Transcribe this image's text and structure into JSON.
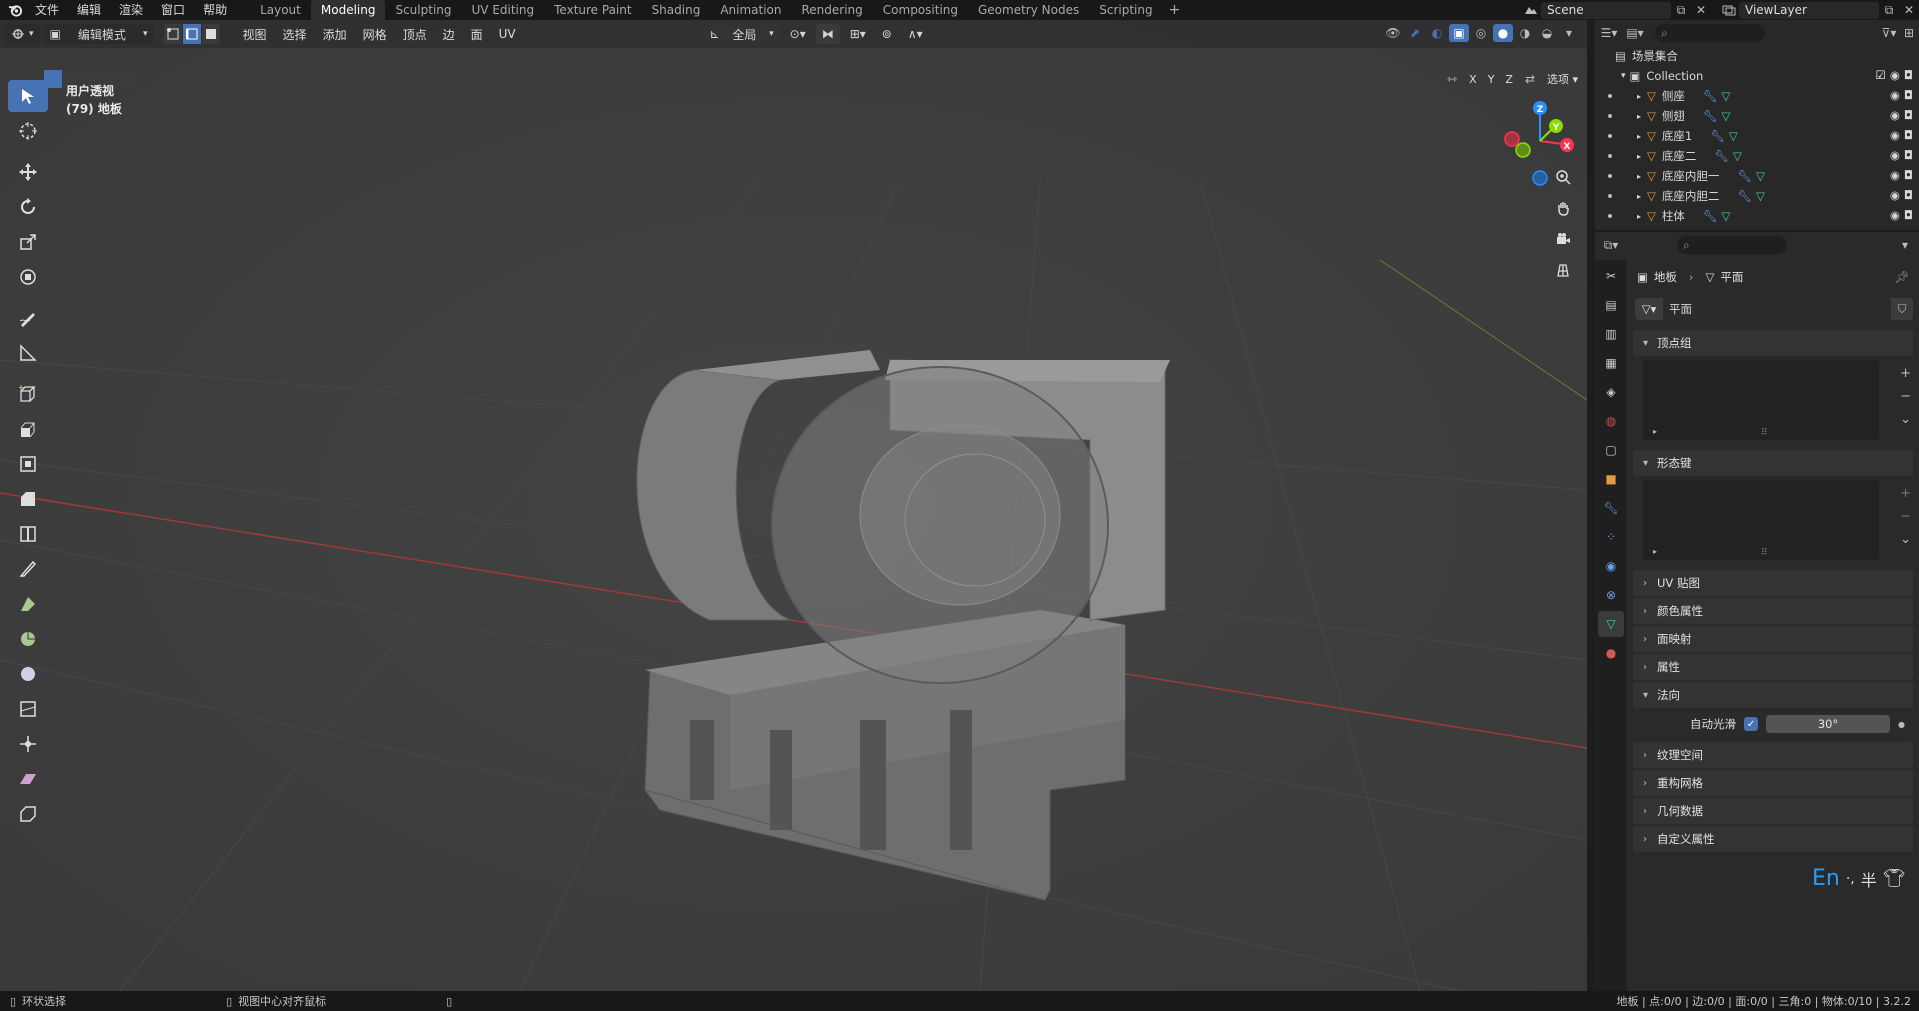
{
  "top_menu": [
    "文件",
    "编辑",
    "渲染",
    "窗口",
    "帮助"
  ],
  "workspaces": [
    "Layout",
    "Modeling",
    "Sculpting",
    "UV Editing",
    "Texture Paint",
    "Shading",
    "Animation",
    "Rendering",
    "Compositing",
    "Geometry Nodes",
    "Scripting"
  ],
  "active_workspace": "Modeling",
  "scene_name": "Scene",
  "view_layer": "ViewLayer",
  "viewport": {
    "mode": "编辑模式",
    "menus": [
      "视图",
      "选择",
      "添加",
      "网格",
      "顶点",
      "边",
      "面",
      "UV"
    ],
    "transform_orientation": "全局",
    "options_label": "选项",
    "mirror_axes": [
      "X",
      "Y",
      "Z"
    ],
    "view_name": "用户透视",
    "object_info": "(79) 地板"
  },
  "gizmo": {
    "x": "X",
    "y": "Y",
    "z": "Z"
  },
  "outliner": {
    "root": "场景集合",
    "collection": "Collection",
    "objects": [
      "侧座",
      "侧翅",
      "底座1",
      "底座二",
      "底座内胆一",
      "底座内胆二",
      "柱体"
    ]
  },
  "properties": {
    "breadcrumb_object": "地板",
    "breadcrumb_mesh": "平面",
    "mesh_name": "平面",
    "panels": {
      "vertex_groups": "顶点组",
      "shape_keys": "形态键",
      "uv_maps": "UV 贴图",
      "color_attributes": "颜色属性",
      "face_maps": "面映射",
      "attributes": "属性",
      "normals": "法向",
      "texture_space": "纹理空间",
      "remesh": "重构网格",
      "geometry_data": "几何数据",
      "custom_props": "自定义属性"
    },
    "auto_smooth_label": "自动光滑",
    "auto_smooth_checked": true,
    "auto_smooth_angle": "30°"
  },
  "ime": {
    "lang": "En",
    "punct": "·,",
    "width": "半"
  },
  "statusbar": {
    "left_action": "环状选择",
    "mid_action": "视图中心对齐鼠标",
    "stats": "地板 | 点:0/0 | 边:0/0 | 面:0/0 | 三角:0 | 物体:0/10 | 3.2.2"
  },
  "colors": {
    "accent": "#4772b3",
    "object_icon": "#e59a3d",
    "mesh_icon": "#49c8a0",
    "modifier_icon": "#6a9dea",
    "axis_x": "#ff3352",
    "axis_y": "#8bdc00",
    "axis_z": "#2890ff"
  }
}
